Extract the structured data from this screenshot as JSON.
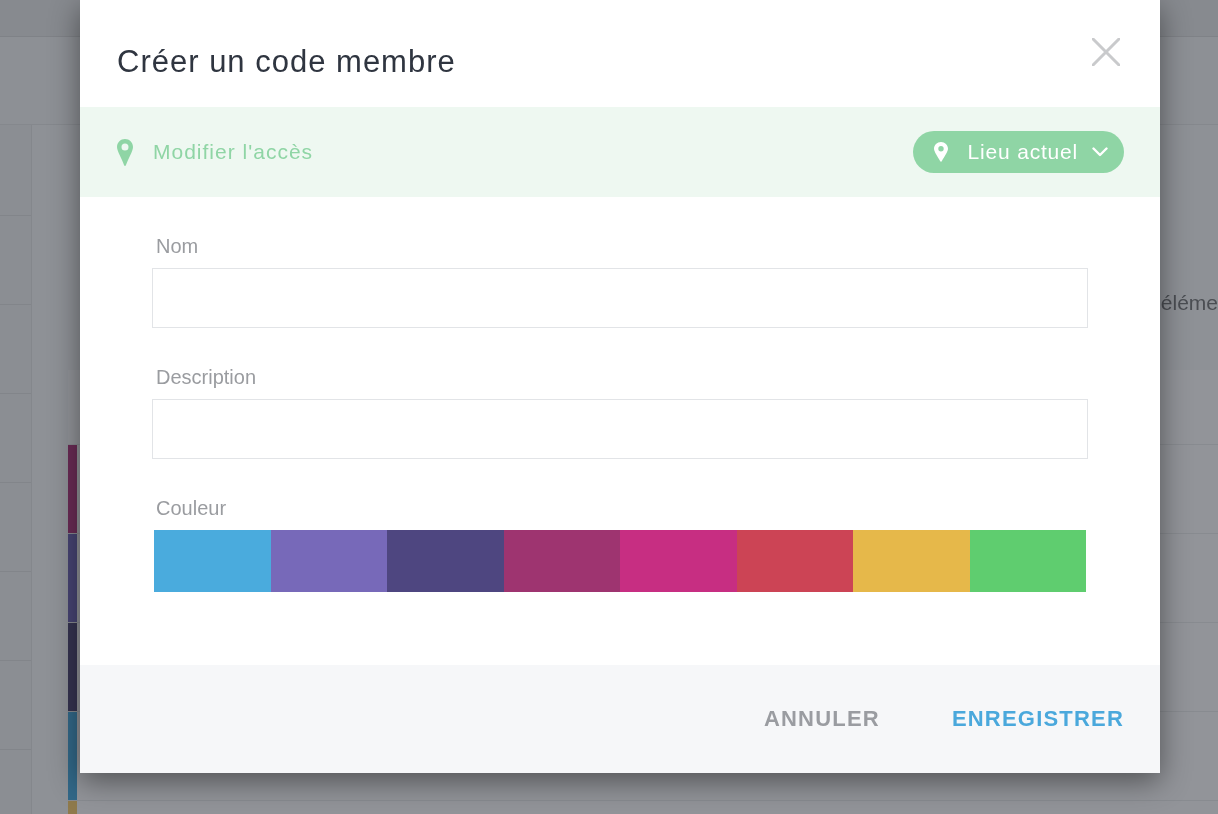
{
  "background": {
    "partial_text": "éléme",
    "rows": [
      {
        "color": "#6a2b55"
      },
      {
        "color": "#474473"
      },
      {
        "color": "#353350"
      },
      {
        "color": "#326888"
      },
      {
        "color": "#8f7a4c"
      }
    ]
  },
  "dialog": {
    "title": "Créer un code membre",
    "access_bar": {
      "label": "Modifier l'accès",
      "location_button": "Lieu actuel"
    },
    "fields": [
      {
        "label": "Nom",
        "kind": "text"
      },
      {
        "label": "Description",
        "kind": "text"
      }
    ],
    "color_picker": {
      "label": "Couleur",
      "swatches": [
        {
          "color": "#4aabdd",
          "selected": false
        },
        {
          "color": "#7769b9",
          "selected": false
        },
        {
          "color": "#4e4680",
          "selected": false
        },
        {
          "color": "#9e3470",
          "selected": false
        },
        {
          "color": "#c72e82",
          "selected": false
        },
        {
          "color": "#cc4455",
          "selected": false
        },
        {
          "color": "#e6b84a",
          "selected": false
        },
        {
          "color": "#5fcd6f",
          "selected": false
        }
      ]
    },
    "buttons": [
      {
        "label": "ANNULER",
        "kind": "secondary"
      },
      {
        "label": "ENREGISTRER",
        "kind": "primary"
      }
    ]
  }
}
